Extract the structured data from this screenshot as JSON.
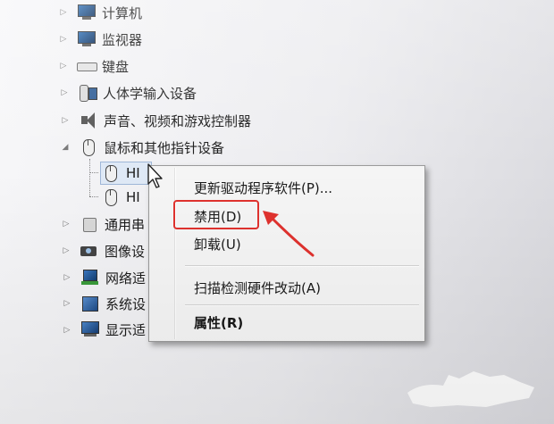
{
  "tree": {
    "items": [
      {
        "label": "计算机",
        "icon": "computer-icon",
        "expanded": false
      },
      {
        "label": "监视器",
        "icon": "monitor-icon",
        "expanded": false
      },
      {
        "label": "键盘",
        "icon": "keyboard-icon",
        "expanded": false
      },
      {
        "label": "人体学输入设备",
        "icon": "hid-icon",
        "expanded": false
      },
      {
        "label": "声音、视频和游戏控制器",
        "icon": "speaker-icon",
        "expanded": false
      },
      {
        "label": "鼠标和其他指针设备",
        "icon": "mouse-icon",
        "expanded": true
      },
      {
        "label": "HI",
        "icon": "mouse-icon",
        "child": true,
        "selected": true
      },
      {
        "label": "HI",
        "icon": "mouse-icon",
        "child": true
      },
      {
        "label": "通用串",
        "icon": "usb-icon",
        "expanded": false
      },
      {
        "label": "图像设",
        "icon": "camera-icon",
        "expanded": false
      },
      {
        "label": "网络适",
        "icon": "network-icon",
        "expanded": false
      },
      {
        "label": "系统设",
        "icon": "system-icon",
        "expanded": false
      },
      {
        "label": "显示适",
        "icon": "display-icon",
        "expanded": false
      }
    ],
    "expander_collapsed": "▷",
    "expander_expanded": "◢"
  },
  "context_menu": {
    "items": [
      {
        "label": "更新驱动程序软件(P)...",
        "bold": false
      },
      {
        "label": "禁用(D)",
        "bold": false,
        "highlighted": true
      },
      {
        "label": "卸载(U)",
        "bold": false
      },
      {
        "label": "扫描检测硬件改动(A)",
        "bold": false
      },
      {
        "label": "属性(R)",
        "bold": true
      }
    ]
  },
  "annotation": {
    "highlight_color": "#e0322e"
  }
}
